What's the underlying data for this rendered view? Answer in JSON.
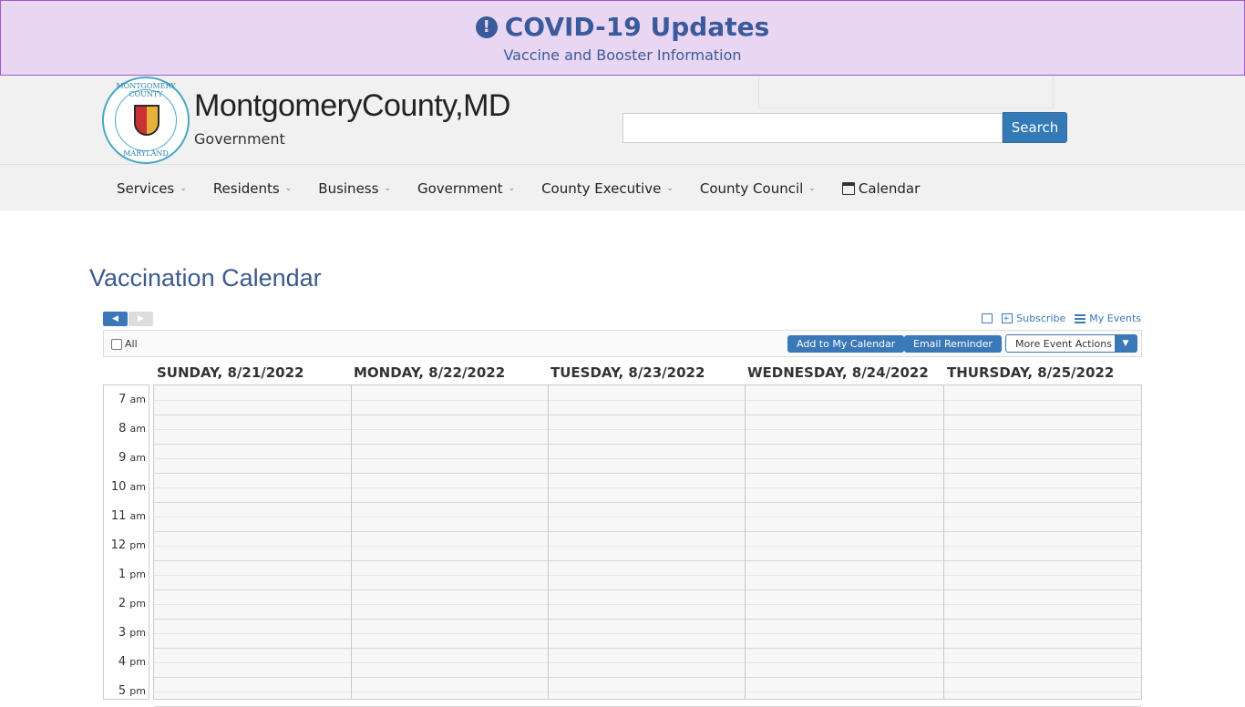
{
  "banner": {
    "icon": "exclamation-circle-icon",
    "title": "COVID-19 Updates",
    "subtitle": "Vaccine and Booster Information"
  },
  "header": {
    "seal_top": "MONTGOMERY COUNTY",
    "seal_bottom": "MARYLAND",
    "title": "MontgomeryCounty,MD",
    "subtitle": "Government",
    "search_placeholder": "",
    "search_button": "Search"
  },
  "nav": {
    "items": [
      {
        "label": "Services"
      },
      {
        "label": "Residents"
      },
      {
        "label": "Business"
      },
      {
        "label": "Government"
      },
      {
        "label": "County Executive"
      },
      {
        "label": "County Council"
      }
    ],
    "calendar_label": "Calendar"
  },
  "page": {
    "title": "Vaccination Calendar"
  },
  "calendar": {
    "links": {
      "subscribe": "Subscribe",
      "my_events": "My Events"
    },
    "all_label": "All",
    "add_button": "Add to My Calendar",
    "email_button": "Email Reminder",
    "more_button": "More Event Actions",
    "days": [
      "SUNDAY, 8/21/2022",
      "MONDAY, 8/22/2022",
      "TUESDAY, 8/23/2022",
      "WEDNESDAY, 8/24/2022",
      "THURSDAY, 8/25/2022"
    ],
    "times": [
      {
        "hour": "7",
        "period": "am"
      },
      {
        "hour": "8",
        "period": "am"
      },
      {
        "hour": "9",
        "period": "am"
      },
      {
        "hour": "10",
        "period": "am"
      },
      {
        "hour": "11",
        "period": "am"
      },
      {
        "hour": "12",
        "period": "pm"
      },
      {
        "hour": "1",
        "period": "pm"
      },
      {
        "hour": "2",
        "period": "pm"
      },
      {
        "hour": "3",
        "period": "pm"
      },
      {
        "hour": "4",
        "period": "pm"
      },
      {
        "hour": "5",
        "period": "pm"
      }
    ]
  }
}
